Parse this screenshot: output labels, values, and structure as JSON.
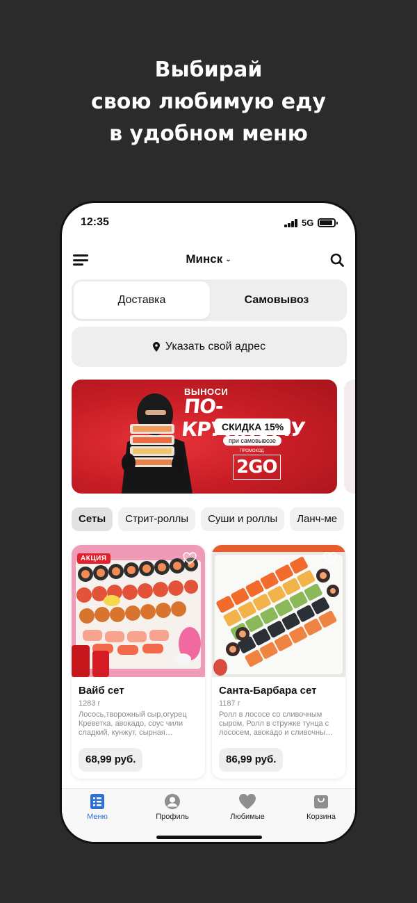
{
  "promo_headline": [
    "Выбирай",
    "свою любимую еду",
    "в удобном меню"
  ],
  "status_bar": {
    "time": "12:35",
    "network": "5G"
  },
  "header": {
    "city": "Минск",
    "chevron_icon": "chevron-down-icon",
    "menu_icon": "hamburger-icon",
    "search_icon": "search-icon"
  },
  "delivery_toggle": {
    "options": [
      "Доставка",
      "Самовывоз"
    ],
    "selected": "Доставка"
  },
  "address": {
    "label": "Указать свой адрес",
    "icon": "location-pin-icon"
  },
  "banner": {
    "line1": "ВЫНОСИ",
    "line2": "ПО-КРУПНОМУ",
    "discount": "СКИДКА 15%",
    "condition": "при самовывозе",
    "promo_label": "ПРОМОКОД",
    "promo_code": "2GO",
    "accent_color": "#d8222a"
  },
  "categories": [
    "Сеты",
    "Стрит-роллы",
    "Суши и роллы",
    "Ланч-ме"
  ],
  "selected_category": "Сеты",
  "products": [
    {
      "badge": "АКЦИЯ",
      "title": "Вайб сет",
      "weight": "1283 г",
      "description": "Лосось,творожный сыр,огурец Креветка, авокадо, соус чили сладкий, кунжут, сырная…",
      "price": "68,99 руб."
    },
    {
      "badge": "",
      "title": "Санта-Барбара сет",
      "weight": "1187 г",
      "description": "Ролл в лососе со сливочным сыром, Ролл в стружке тунца с лососем, авокадо и сливочны…",
      "price": "86,99 руб."
    }
  ],
  "tab_bar": [
    {
      "label": "Меню",
      "icon": "menu-list-icon",
      "active": true
    },
    {
      "label": "Профиль",
      "icon": "profile-icon",
      "active": false
    },
    {
      "label": "Любимые",
      "icon": "heart-icon",
      "active": false
    },
    {
      "label": "Корзина",
      "icon": "cart-bag-icon",
      "active": false
    }
  ],
  "colors": {
    "accent_blue": "#2e6fd6",
    "sale_red": "#e3212b",
    "background": "#2b2b2b"
  }
}
